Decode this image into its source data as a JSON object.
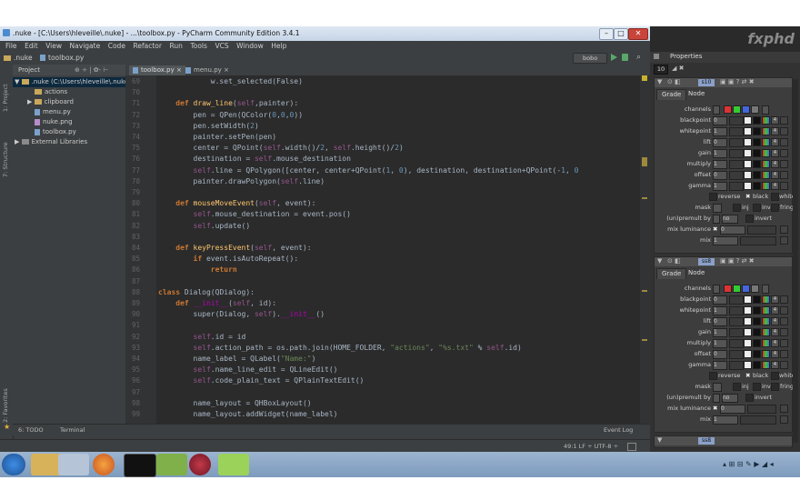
{
  "window": {
    "title": ".nuke - [C:\\Users\\hleveille\\.nuke] - ...\\toolbox.py - PyCharm Community Edition 3.4.1",
    "controls": [
      "–",
      "□",
      "✕"
    ]
  },
  "menu": [
    "File",
    "Edit",
    "View",
    "Navigate",
    "Code",
    "Refactor",
    "Run",
    "Tools",
    "VCS",
    "Window",
    "Help"
  ],
  "navbar": {
    "crumb1": ".nuke",
    "crumb2": "toolbox.py",
    "run_config": "bobo"
  },
  "sidebar_tabs": [
    "1: Project",
    "7: Structure",
    "2: Favorites"
  ],
  "project": {
    "header": "Project",
    "root": ".nuke (C:\\Users\\hleveille\\.nuke)",
    "items": [
      "actions",
      "clipboard",
      "menu.py",
      "nuke.png",
      "toolbox.py",
      "External Libraries"
    ]
  },
  "editor": {
    "tabs": [
      "toolbox.py",
      "menu.py"
    ],
    "line_numbers": [
      "69",
      "70",
      "71",
      "72",
      "73",
      "74",
      "75",
      "76",
      "77",
      "78",
      "79",
      "80",
      "81",
      "82",
      "83",
      "84",
      "85",
      "86",
      "87",
      "88",
      "89",
      "90",
      "91",
      "92",
      "93",
      "94",
      "95",
      "96",
      "97",
      "98",
      "99"
    ]
  },
  "bottom": {
    "todo": "6: TODO",
    "terminal": "Terminal",
    "event_log": "Event Log",
    "status": "49:1   LF ÷   UTF-8 ÷"
  },
  "nuke": {
    "logo": "fxphd",
    "properties_title": "Properties",
    "properties_count": "10",
    "panels": [
      {
        "node": "s10",
        "tabs": [
          "Grade",
          "Node"
        ],
        "labels": [
          "channels",
          "blackpoint",
          "whitepoint",
          "lift",
          "gain",
          "multiply",
          "offset",
          "gamma"
        ],
        "values": [
          "0",
          "1",
          "0",
          "1",
          "1",
          "0",
          "1"
        ],
        "checks": [
          "reverse",
          "black",
          "white"
        ],
        "mask": "mask",
        "mask_opts": [
          "inj",
          "inv",
          "fringe"
        ],
        "unpremult_label": "(un)premult by",
        "unpremult_value": "no",
        "invert": "invert",
        "mix_lum_label": "mix luminance",
        "mix_lum_value": "0",
        "mix_label": "mix",
        "mix_value": "1"
      },
      {
        "node": "ss8",
        "tabs": [
          "Grade",
          "Node"
        ],
        "labels": [
          "channels",
          "blackpoint",
          "whitepoint",
          "lift",
          "gain",
          "multiply",
          "offset",
          "gamma"
        ],
        "values": [
          "0",
          "1",
          "0",
          "1",
          "1",
          "0",
          "1"
        ],
        "checks": [
          "reverse",
          "black",
          "white"
        ],
        "mask": "mask",
        "mask_opts": [
          "inj",
          "inv",
          "fringe"
        ],
        "unpremult_label": "(un)premult by",
        "unpremult_value": "no",
        "invert": "invert",
        "mix_lum_label": "mix luminance",
        "mix_lum_value": "0",
        "mix_label": "mix",
        "mix_value": "1"
      }
    ],
    "third_node": "ss8"
  },
  "taskbar": {
    "apps": [
      "windows-start",
      "file-explorer",
      "media",
      "firefox",
      "terminal",
      "pycharm",
      "nuke-app",
      "green-app"
    ]
  },
  "colors": {
    "editor_bg": "#2b2b2b",
    "keyword": "#cc7832",
    "self": "#94558d",
    "string": "#6a8759",
    "function": "#ffc66d",
    "number": "#6897bb"
  }
}
